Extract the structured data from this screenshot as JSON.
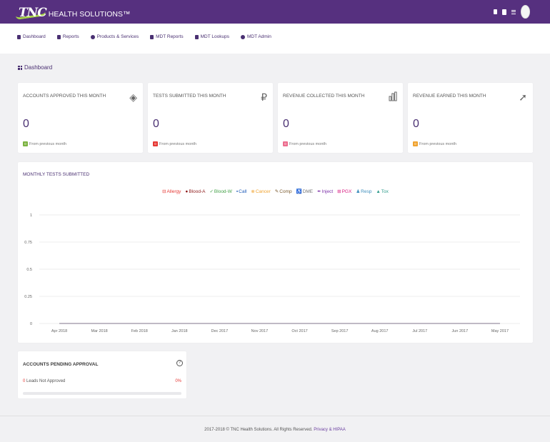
{
  "brand": {
    "logo_main": "TNC",
    "logo_sub": "HEALTH SOLUTIONS™"
  },
  "topbar_icons": [
    "document-icon",
    "clipboard-icon",
    "menu-icon",
    "avatar"
  ],
  "nav": [
    {
      "label": "Dashboard",
      "icon": "grid-icon"
    },
    {
      "label": "Reports",
      "icon": "document-icon"
    },
    {
      "label": "Products & Services",
      "icon": "cubes-icon"
    },
    {
      "label": "MDT Reports",
      "icon": "clipboard-icon"
    },
    {
      "label": "MDT Lookups",
      "icon": "folder-icon"
    },
    {
      "label": "MDT Admin",
      "icon": "user-icon"
    }
  ],
  "page_title": "Dashboard",
  "stats": [
    {
      "title": "ACCOUNTS APPROVED THIS MONTH",
      "value": "0",
      "foot": "From previous month",
      "badge": "0",
      "badge_color": "#7cb342",
      "icon": "layers-icon",
      "icon_char": "◈"
    },
    {
      "title": "TESTS SUBMITTED THIS MONTH",
      "value": "0",
      "foot": "From previous month",
      "badge": "0",
      "badge_color": "#e53935",
      "icon": "currency-icon",
      "icon_char": "₽"
    },
    {
      "title": "REVENUE COLLECTED THIS MONTH",
      "value": "0",
      "foot": "From previous month",
      "badge": "0",
      "badge_color": "#ec6d8e",
      "icon": "bar-chart-icon",
      "icon_char": "▮"
    },
    {
      "title": "REVENUE EARNED THIS MONTH",
      "value": "0",
      "foot": "From previous month",
      "badge": "0",
      "badge_color": "#f0a330",
      "icon": "rocket-icon",
      "icon_char": "➚"
    }
  ],
  "chart_data": {
    "type": "line",
    "title": "MONTHLY TESTS SUBMITTED",
    "categories": [
      "Apr 2018",
      "Mar 2018",
      "Feb 2018",
      "Jan 2018",
      "Dec 2017",
      "Nov 2017",
      "Oct 2017",
      "Sep 2017",
      "Aug 2017",
      "Jul 2017",
      "Jun 2017",
      "May 2017"
    ],
    "yticks": [
      "1",
      "0.75",
      "0.5",
      "0.25",
      "0"
    ],
    "ylim": [
      0,
      1
    ],
    "grid": true,
    "legend_position": "top-center",
    "series": [
      {
        "name": "Allergy",
        "color": "#e53935",
        "symbol": "⊟",
        "values": [
          0,
          0,
          0,
          0,
          0,
          0,
          0,
          0,
          0,
          0,
          0,
          0
        ]
      },
      {
        "name": "Blood-A",
        "color": "#8e1c1c",
        "symbol": "●",
        "values": [
          0,
          0,
          0,
          0,
          0,
          0,
          0,
          0,
          0,
          0,
          0,
          0
        ]
      },
      {
        "name": "Blood-W",
        "color": "#43a047",
        "symbol": "✓",
        "values": [
          0,
          0,
          0,
          0,
          0,
          0,
          0,
          0,
          0,
          0,
          0,
          0
        ]
      },
      {
        "name": "Call",
        "color": "#1e5bb8",
        "symbol": "▪",
        "values": [
          0,
          0,
          0,
          0,
          0,
          0,
          0,
          0,
          0,
          0,
          0,
          0
        ]
      },
      {
        "name": "Cancer",
        "color": "#f0a330",
        "symbol": "⊗",
        "values": [
          0,
          0,
          0,
          0,
          0,
          0,
          0,
          0,
          0,
          0,
          0,
          0
        ]
      },
      {
        "name": "Comp",
        "color": "#7a5a2e",
        "symbol": "✎",
        "values": [
          0,
          0,
          0,
          0,
          0,
          0,
          0,
          0,
          0,
          0,
          0,
          0
        ]
      },
      {
        "name": "DME",
        "color": "#777777",
        "symbol": "♿",
        "values": [
          0,
          0,
          0,
          0,
          0,
          0,
          0,
          0,
          0,
          0,
          0,
          0
        ]
      },
      {
        "name": "Inject",
        "color": "#7b2fa8",
        "symbol": "✒",
        "values": [
          0,
          0,
          0,
          0,
          0,
          0,
          0,
          0,
          0,
          0,
          0,
          0
        ]
      },
      {
        "name": "PGX",
        "color": "#d81b80",
        "symbol": "⊞",
        "values": [
          0,
          0,
          0,
          0,
          0,
          0,
          0,
          0,
          0,
          0,
          0,
          0
        ]
      },
      {
        "name": "Resp",
        "color": "#3c8dbc",
        "symbol": "♟",
        "values": [
          0,
          0,
          0,
          0,
          0,
          0,
          0,
          0,
          0,
          0,
          0,
          0
        ]
      },
      {
        "name": "Tox",
        "color": "#2e9b8b",
        "symbol": "▲",
        "values": [
          0,
          0,
          0,
          0,
          0,
          0,
          0,
          0,
          0,
          0,
          0,
          0
        ]
      }
    ]
  },
  "pending": {
    "title": "ACCOUNTS PENDING APPROVAL",
    "count": "0",
    "row_label": "Leads Not Approved",
    "percent": "0%",
    "progress": 0
  },
  "footer": {
    "text": "2017-2018 © TNC Health Solutions. All Rights Reserved.",
    "link": "Privacy & HIPAA"
  }
}
